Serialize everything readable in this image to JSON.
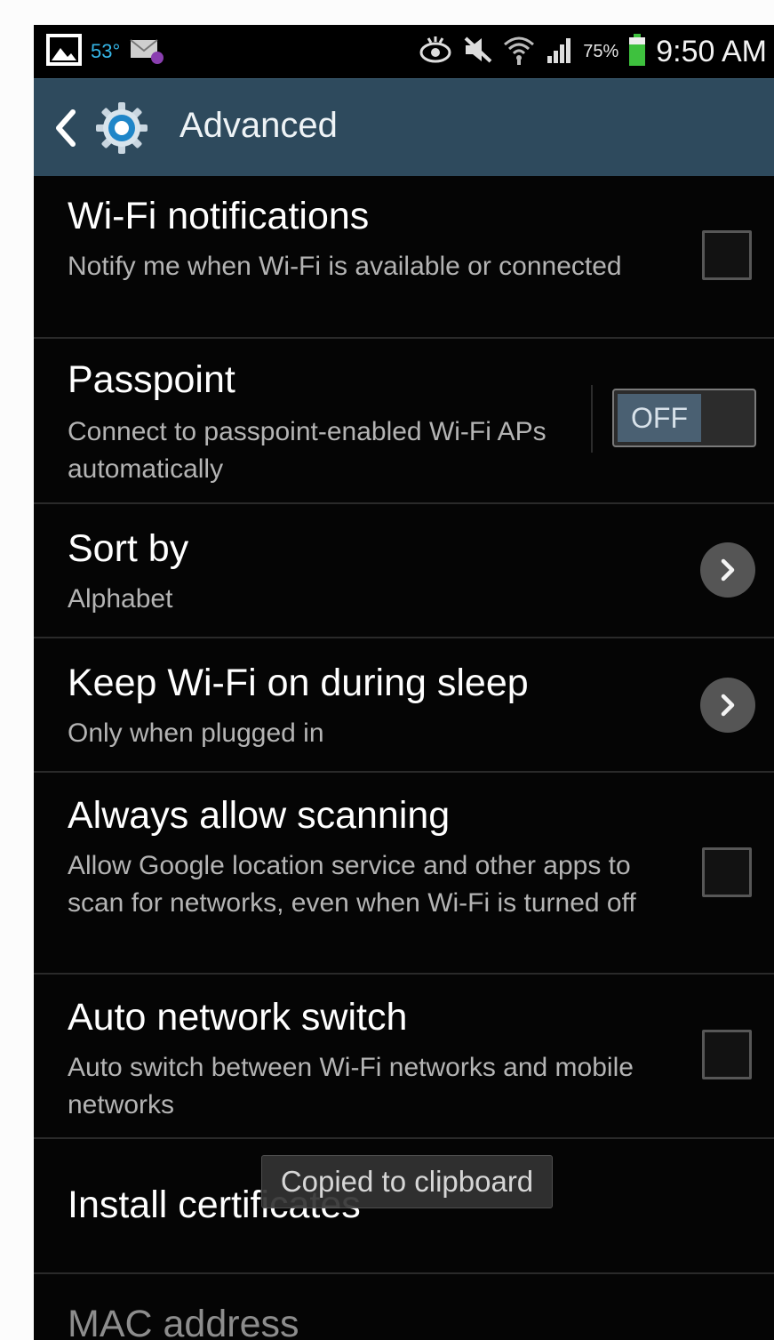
{
  "status_bar": {
    "temperature": "53°",
    "battery_percent": "75%",
    "time": "9:50 AM",
    "icons": [
      "gallery-icon",
      "email-icon",
      "eye-icon",
      "mute-icon",
      "wifi-icon",
      "signal-icon",
      "battery-icon"
    ]
  },
  "action_bar": {
    "title": "Advanced",
    "icons": [
      "back-chevron-icon",
      "settings-gear-icon"
    ]
  },
  "settings": {
    "wifi_notifications": {
      "title": "Wi-Fi notifications",
      "subtitle": "Notify me when Wi-Fi is available or connected",
      "checked": false
    },
    "passpoint": {
      "title": "Passpoint",
      "subtitle": "Connect to passpoint-enabled Wi-Fi APs automatically",
      "toggle_label": "OFF"
    },
    "sort_by": {
      "title": "Sort by",
      "subtitle": "Alphabet"
    },
    "keep_wifi_on": {
      "title": "Keep Wi-Fi on during sleep",
      "subtitle": "Only when plugged in"
    },
    "always_allow_scanning": {
      "title": "Always allow scanning",
      "subtitle": "Allow Google location service and other apps to scan for networks, even when Wi-Fi is turned off",
      "checked": false
    },
    "auto_network_switch": {
      "title": "Auto network switch",
      "subtitle": "Auto switch between Wi-Fi networks and mobile networks",
      "checked": false
    },
    "install_certificates": {
      "title": "Install certificates"
    },
    "mac_address": {
      "title": "MAC address"
    }
  },
  "toast": {
    "message": "Copied to clipboard"
  },
  "colors": {
    "action_bar": "#2e4a5d",
    "accent_blue": "#35b6e8",
    "background": "#050505",
    "battery_green": "#3ec13e"
  }
}
